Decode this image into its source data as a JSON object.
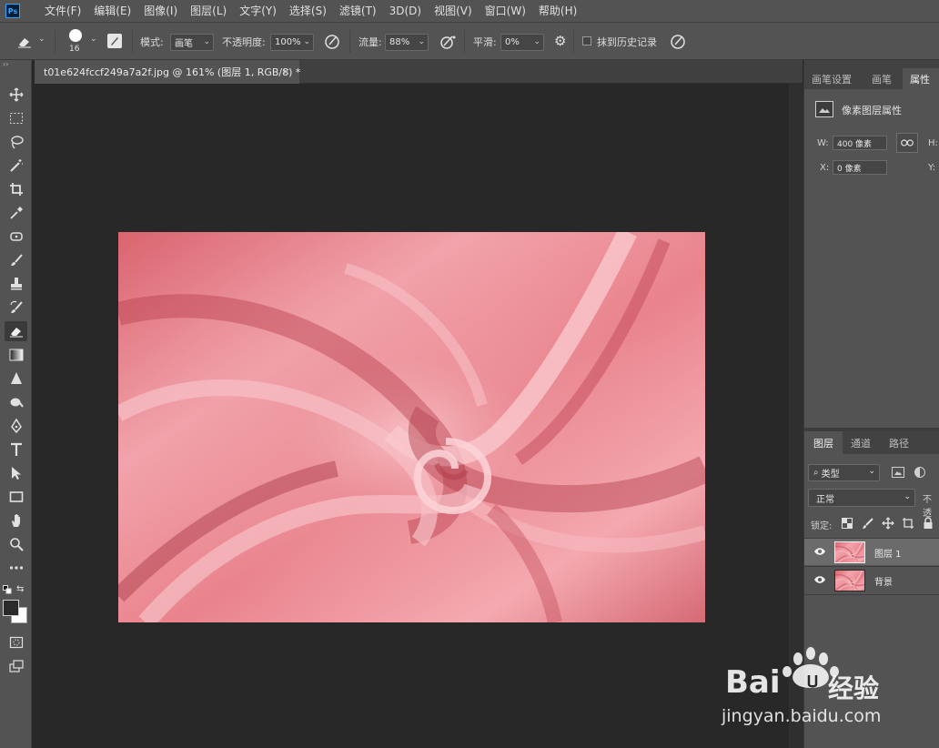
{
  "app": {
    "logo_text": "Ps"
  },
  "menu": [
    "文件(F)",
    "编辑(E)",
    "图像(I)",
    "图层(L)",
    "文字(Y)",
    "选择(S)",
    "滤镜(T)",
    "3D(D)",
    "视图(V)",
    "窗口(W)",
    "帮助(H)"
  ],
  "options": {
    "brush_size": "16",
    "mode_label": "模式:",
    "mode_value": "画笔",
    "opacity_label": "不透明度:",
    "opacity_value": "100%",
    "flow_label": "流量:",
    "flow_value": "88%",
    "smooth_label": "平滑:",
    "smooth_value": "0%",
    "erase_history_label": "抹到历史记录"
  },
  "document": {
    "tab_title": "t01e624fccf249a7a2f.jpg @ 161% (图层 1, RGB/8) *",
    "close_glyph": "×"
  },
  "tools": [
    "move-icon",
    "marquee-icon",
    "lasso-icon",
    "magic-wand-icon",
    "crop-icon",
    "eyedropper-icon",
    "healing-brush-icon",
    "brush-icon",
    "stamp-icon",
    "history-brush-icon",
    "eraser-icon",
    "gradient-icon",
    "blur-icon",
    "dodge-icon",
    "pen-icon",
    "type-icon",
    "path-select-icon",
    "rectangle-icon",
    "hand-icon",
    "zoom-icon",
    "more-tools-icon"
  ],
  "right_panel": {
    "tabs": [
      "画笔设置",
      "画笔",
      "属性"
    ],
    "properties_title": "像素图层属性",
    "w_label": "W:",
    "w_value": "400 像素",
    "h_label": "H:",
    "x_label": "X:",
    "x_value": "0 像素",
    "y_label": "Y:"
  },
  "layers_panel": {
    "tabs": [
      "图层",
      "通道",
      "路径"
    ],
    "filter_value": "类型",
    "blend_mode": "正常",
    "opacity_label_trunc": "不透",
    "lock_label": "锁定:",
    "layers": [
      {
        "name": "图层 1",
        "selected": true
      },
      {
        "name": "背景",
        "selected": false
      }
    ]
  },
  "watermark": {
    "brand_left": "Bai",
    "brand_right": "经验",
    "url": "jingyan.baidu.com"
  },
  "colors": {
    "ui_gray": "#535353",
    "canvas_bg": "#282828",
    "accent_blue": "#31a8ff",
    "satin_pink": "#e47a85"
  }
}
